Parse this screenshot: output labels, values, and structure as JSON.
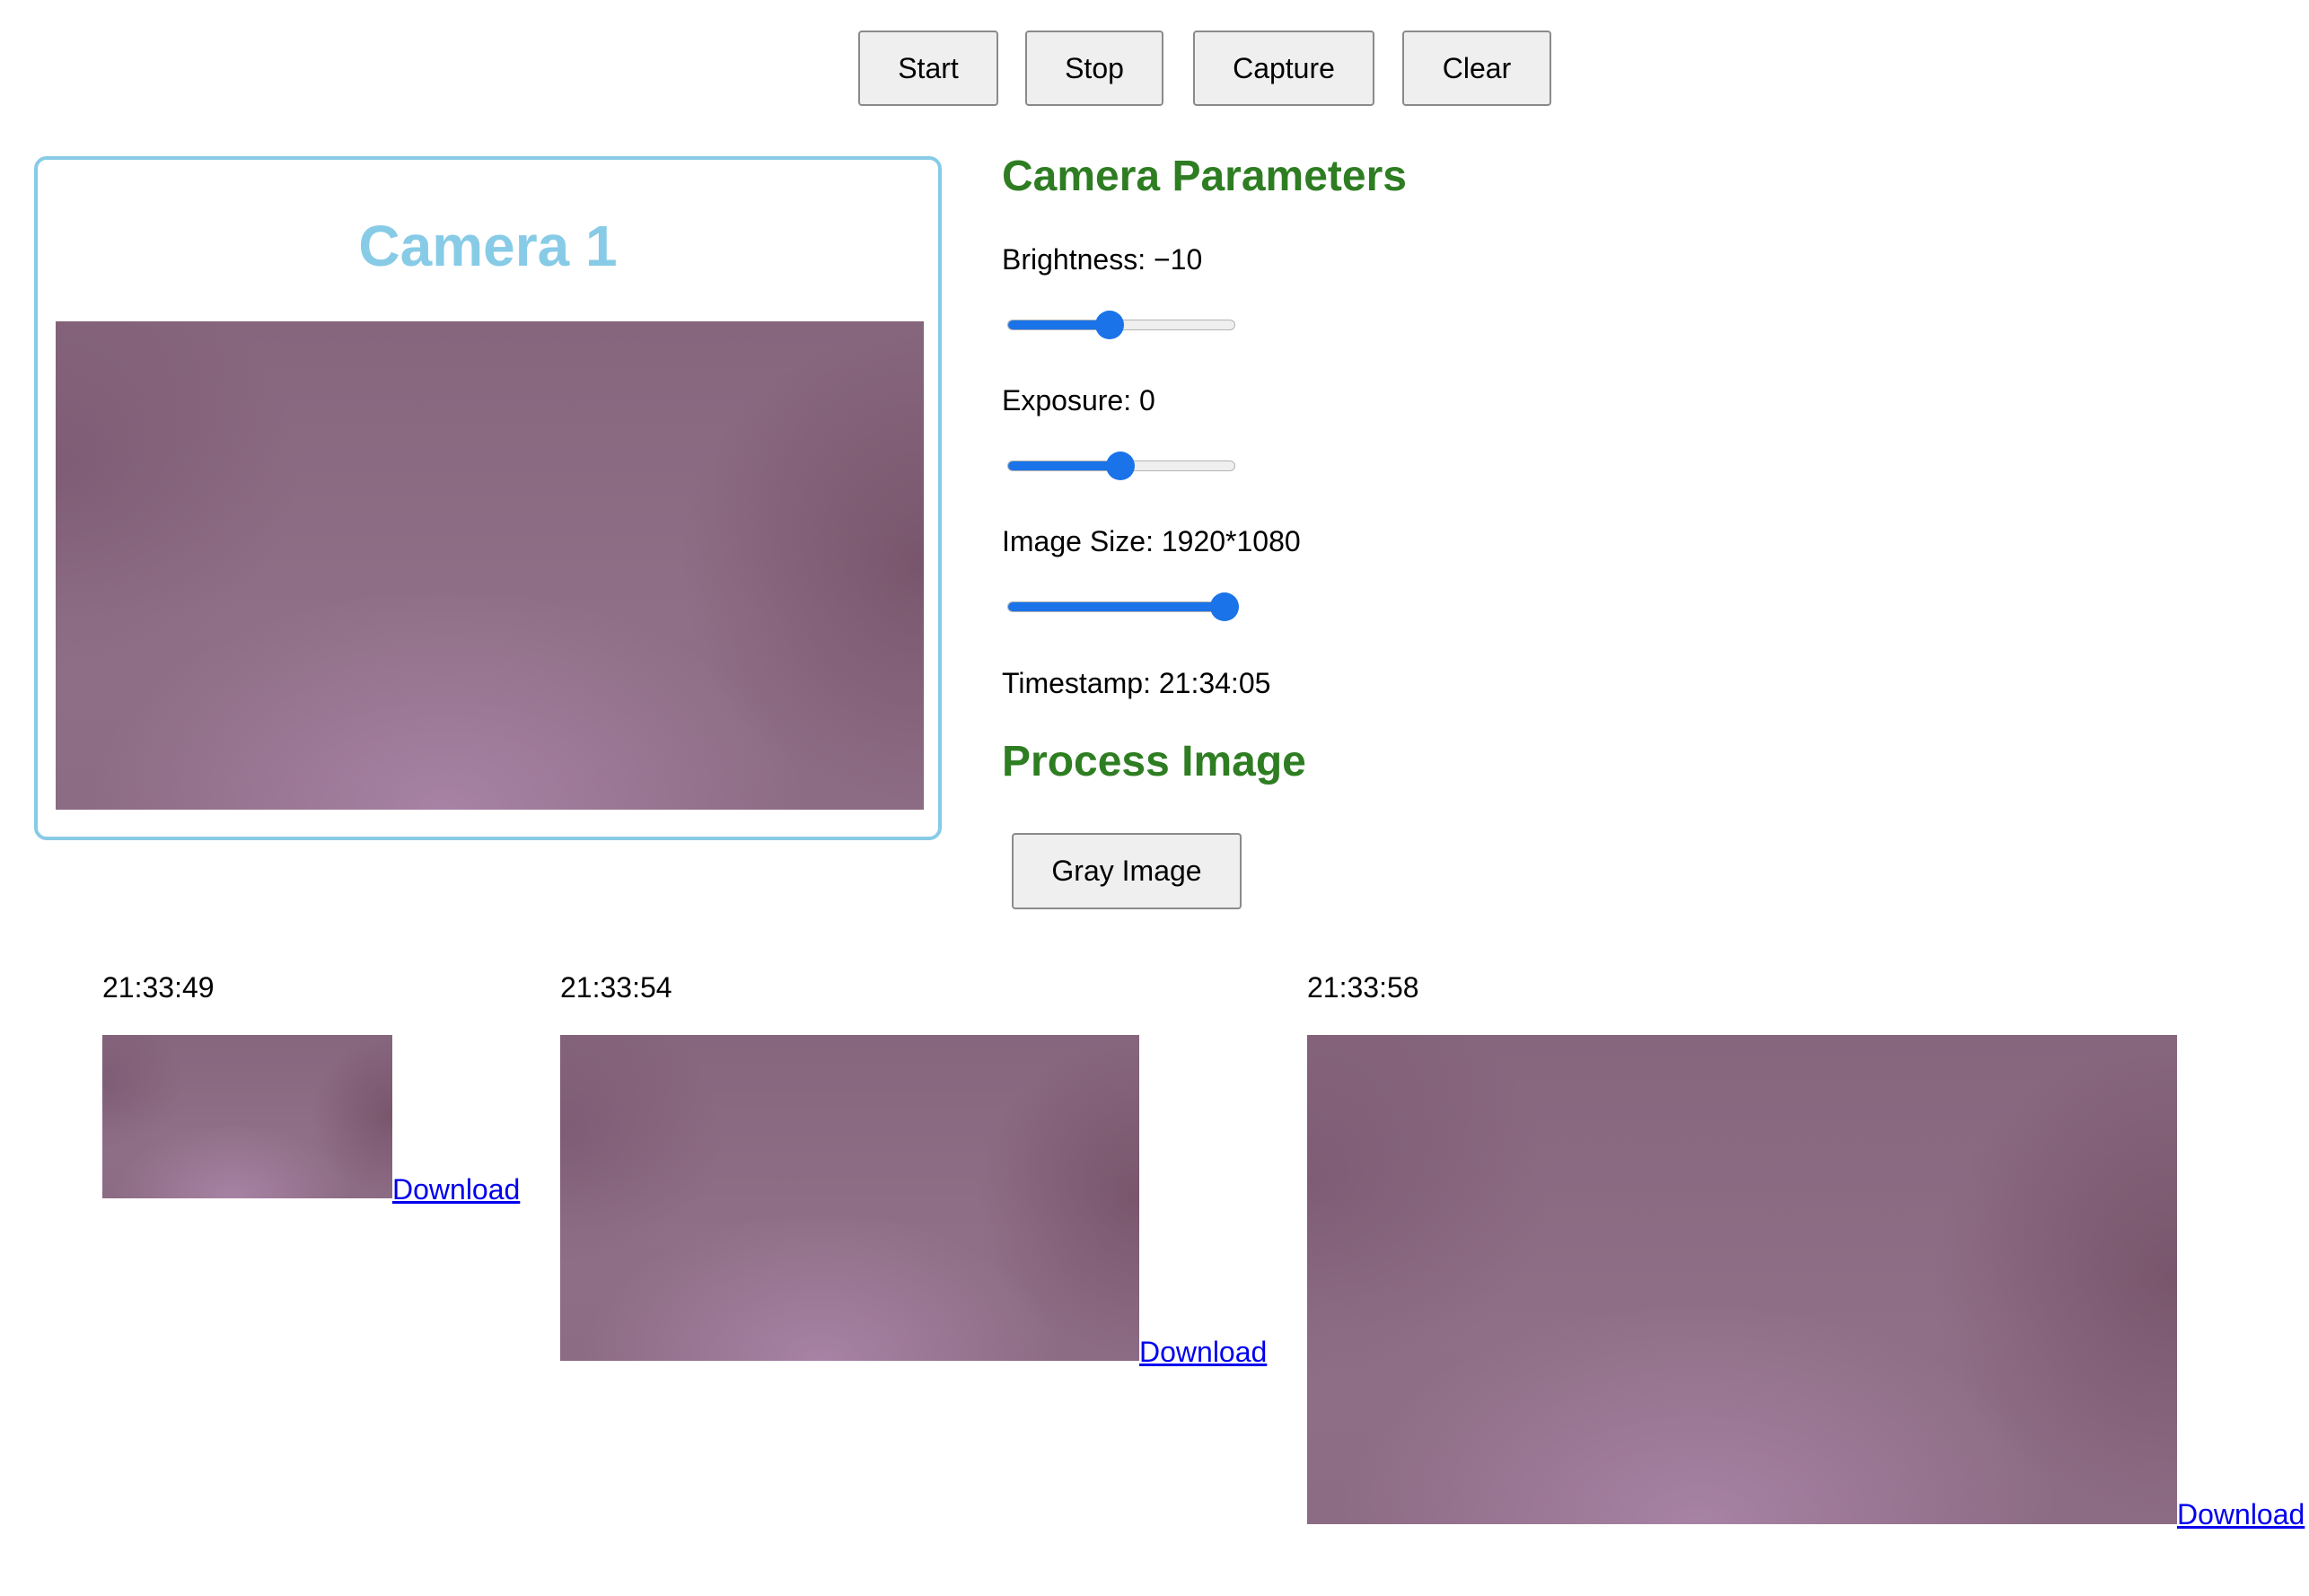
{
  "toolbar": {
    "start_label": "Start",
    "stop_label": "Stop",
    "capture_label": "Capture",
    "clear_label": "Clear"
  },
  "camera": {
    "title": "Camera 1"
  },
  "parameters": {
    "heading": "Camera Parameters",
    "brightness": {
      "label": "Brightness: −10",
      "value": -10,
      "fraction": 0.45
    },
    "exposure": {
      "label": "Exposure: 0",
      "value": 0,
      "fraction": 0.5
    },
    "image_size": {
      "label": "Image Size: 1920*1080",
      "value": "1920*1080",
      "fraction": 1.0
    },
    "timestamp": "Timestamp: 21:34:05"
  },
  "process": {
    "heading": "Process Image",
    "gray_label": "Gray Image"
  },
  "captures": [
    {
      "time": "21:33:49",
      "link": "Download"
    },
    {
      "time": "21:33:54",
      "link": "Download"
    },
    {
      "time": "21:33:58",
      "link": "Download"
    }
  ],
  "colors": {
    "accent_blue": "#1a73e8",
    "card_border": "#87cbe6",
    "heading_green": "#2e7d22",
    "link_blue": "#0000ee"
  }
}
